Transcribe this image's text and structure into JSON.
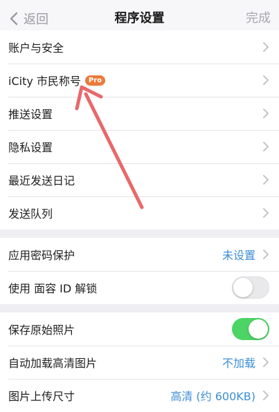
{
  "nav": {
    "back_label": "返回",
    "title": "程序设置",
    "done_label": "完成"
  },
  "group1": {
    "items": [
      {
        "label": "账户与安全"
      },
      {
        "label": "iCity 市民称号",
        "badge": "Pro"
      },
      {
        "label": "推送设置"
      },
      {
        "label": "隐私设置"
      },
      {
        "label": "最近发送日记"
      },
      {
        "label": "发送队列"
      }
    ]
  },
  "group2": {
    "items": [
      {
        "label": "应用密码保护",
        "value": "未设置"
      },
      {
        "label": "使用 面容 ID 解锁",
        "toggle": "off"
      }
    ]
  },
  "group3": {
    "items": [
      {
        "label": "保存原始照片",
        "toggle": "on"
      },
      {
        "label": "自动加载高清图片",
        "value": "不加载"
      },
      {
        "label": "图片上传尺寸",
        "value": "高清 (约 600KB)"
      }
    ]
  },
  "colors": {
    "accent_value": "#3d8ed6",
    "toggle_on": "#4cd465",
    "badge": "#ea7b3b",
    "annotation_arrow": "#e8686b"
  }
}
